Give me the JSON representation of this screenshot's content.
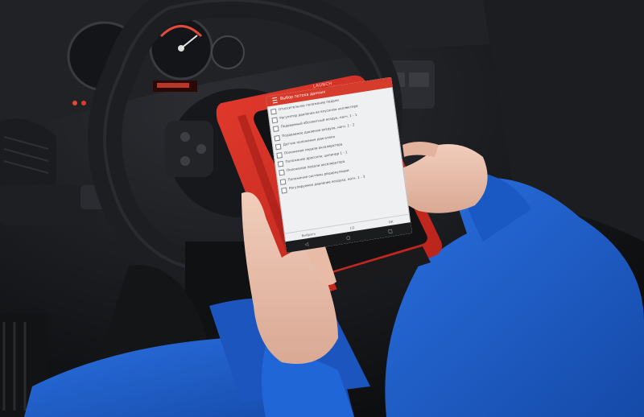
{
  "photo": {
    "subject": "technician holding a red diagnostic tablet in front of a car steering wheel",
    "colors": {
      "uniform": "#1f5fd0",
      "tablet_case": "#d52f25",
      "screen": "#eef0f1",
      "screen_header": "#d63c2c",
      "dashboard": "#17181b"
    }
  },
  "brand": {
    "text": "LAUNCH"
  },
  "tablet": {
    "title": "Выбор потока данных",
    "items": [
      {
        "label": "Относительное положение педали"
      },
      {
        "label": "Регулятор давления во впускном коллекторе"
      },
      {
        "label": "Подаваемый абсолютный воздух, нагн. 1 - 1"
      },
      {
        "label": "Подаваемое давление воздуха, нагн. 1 - 2"
      },
      {
        "label": "Датчик положения двигателя"
      },
      {
        "label": "Положение педали акселератора"
      },
      {
        "label": "Положение дросселя, цилиндр 1 - 1"
      },
      {
        "label": "Положение педали акселератора"
      },
      {
        "label": "Положение системы рециркуляции"
      },
      {
        "label": "Регулируемое давление воздуха, нагн. 1 - 3"
      }
    ],
    "footer": {
      "left": "Выбрать",
      "page": "1/2",
      "right": "ОК"
    },
    "navbar": {
      "back": "◁",
      "home": "○",
      "recent": "□"
    }
  }
}
